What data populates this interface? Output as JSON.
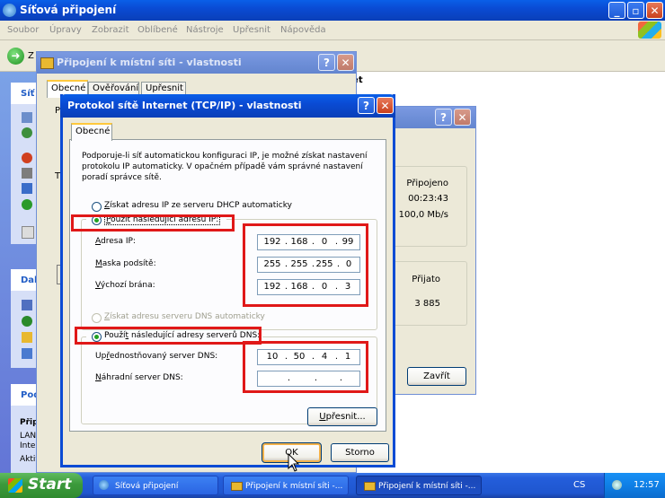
{
  "main_window": {
    "title": "Síťová připojení",
    "menu": [
      "Soubor",
      "Úpravy",
      "Zobrazit",
      "Oblíbené",
      "Nástroje",
      "Upřesnit",
      "Nápověda"
    ],
    "back_label": "Z",
    "sidebar_head_1": "Síť",
    "sidebar_head_2": "Dal",
    "sidebar_head_3": "Pod",
    "details_title": "Připojen",
    "details_lines": [
      "LAN nebo",
      "Internet",
      "Aktivní"
    ],
    "header_suffix": "rnet"
  },
  "lan_dialog": {
    "title": "Připojení k místní síti - vlastnosti",
    "tabs": [
      "Obecné",
      "Ověřování",
      "Upřesnit"
    ],
    "letter_p": "P",
    "letter_t": "T"
  },
  "status_dialog": {
    "status_value": "Připojeno",
    "duration_value": "00:23:43",
    "speed_value": "100,0 Mb/s",
    "received_label": "Přijato",
    "received_value": "3 885",
    "close_label": "Zavřít"
  },
  "tcpip_dialog": {
    "title": "Protokol sítě Internet (TCP/IP) - vlastnosti",
    "tab": "Obecné",
    "description": "Podporuje-li síť automatickou konfiguraci IP, je možné získat nastavení protokolu IP automaticky. V opačném případě vám správné nastavení poradí správce sítě.",
    "radio_auto_ip_pre": "Z",
    "radio_auto_ip": "ískat adresu IP ze serveru DHCP automaticky",
    "radio_manual_ip_pre": "P",
    "radio_manual_ip": "oužít následující adresu IP:",
    "ip_label_pre": "A",
    "ip_label": "dresa IP:",
    "mask_label_pre": "M",
    "mask_label": "aska podsítě:",
    "gateway_label_pre": "V",
    "gateway_label": "ýchozí brána:",
    "ip_octets": [
      "192",
      "168",
      "0",
      "99"
    ],
    "mask_octets": [
      "255",
      "255",
      "255",
      "0"
    ],
    "gateway_octets": [
      "192",
      "168",
      "0",
      "3"
    ],
    "radio_auto_dns_pre": "Z",
    "radio_auto_dns": "ískat adresu serveru DNS automaticky",
    "radio_manual_dns_pre": "Použí",
    "radio_manual_dns_key": "t",
    "radio_manual_dns": " následující adresy serverů DNS:",
    "dns1_label_pre": "Up",
    "dns1_label_key": "ř",
    "dns1_label": "ednostňovaný server DNS:",
    "dns2_label_pre": "N",
    "dns2_label": "áhradní server DNS:",
    "dns1_octets": [
      "10",
      "50",
      "4",
      "1"
    ],
    "dns2_octets": [
      "",
      "",
      "",
      ""
    ],
    "advanced_pre": "U",
    "advanced": "přesnit...",
    "ok_label": "OK",
    "cancel_label": "Storno"
  },
  "taskbar": {
    "start_label": "Start",
    "buttons": [
      "Síťová připojení",
      "Připojení k místní síti -...",
      "Připojení k místní síti -..."
    ],
    "lang": "CS",
    "clock": "12:57"
  },
  "colors": {
    "xp_blue": "#0a4bd4",
    "highlight_red": "#e01818",
    "dialog_bg": "#ece9d8",
    "taskbar_blue": "#245edb",
    "start_green": "#3c9a3c"
  }
}
